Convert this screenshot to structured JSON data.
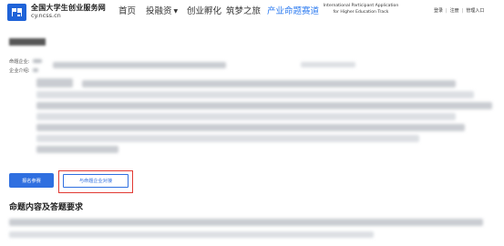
{
  "header": {
    "brand_name": "全国大学生创业服务网",
    "brand_domain": "cy.ncss.cn",
    "nav": [
      {
        "label": "首页",
        "active": false
      },
      {
        "label": "投融资",
        "active": false,
        "dropdown": true
      },
      {
        "label": "创业孵化",
        "active": false
      },
      {
        "label": "筑梦之旅",
        "active": false
      },
      {
        "label": "产业命题赛道",
        "active": true
      }
    ],
    "intl_line1": "International Participant Application",
    "intl_line2": "for Higher Education Track",
    "login": "登录",
    "register": "注册",
    "admin": "管理入口",
    "separator": "|"
  },
  "detail": {
    "proposer_label": "命题企业:",
    "intro_label": "企业介绍:"
  },
  "actions": {
    "signup_button": "报名参赛",
    "contact_button": "与命题企业对接"
  },
  "section": {
    "title": "命题内容及答题要求"
  },
  "colors": {
    "primary": "#2f6fe0",
    "active_nav": "#2d7bf0",
    "highlight": "#e23a33"
  }
}
